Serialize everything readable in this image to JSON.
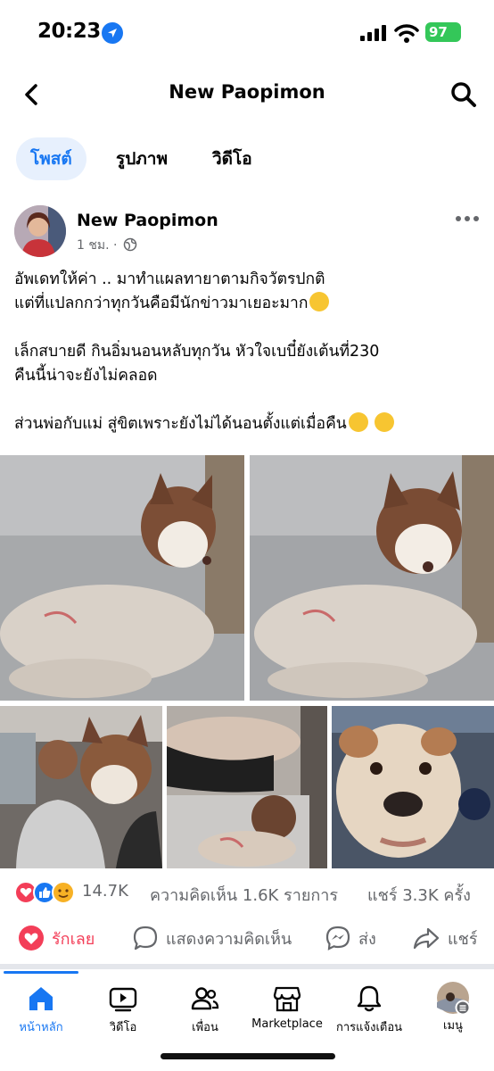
{
  "status_bar": {
    "time": "20:23",
    "battery": "97"
  },
  "header": {
    "title": "New Paopimon"
  },
  "tabs": [
    {
      "label": "โพสต์",
      "active": true
    },
    {
      "label": "รูปภาพ",
      "active": false
    },
    {
      "label": "วิดีโอ",
      "active": false
    }
  ],
  "post": {
    "author": "New Paopimon",
    "time": "1 ชม. ·",
    "text": {
      "line1": "อัพเดทให้ค่า .. มาทำแผลทายาตามกิจวัตรปกติ",
      "line2": "แต่ที่แปลกกว่าทุกวันคือมีนักข่าวมาเยอะมาก",
      "line3": "เล็กสบายดี กินอิ่มนอนหลับทุกวัน หัวใจเบบี๋ยังเต้นที่230",
      "line4": "คืนนี้น่าจะยังไม่คลอด",
      "line5": "ส่วนพ่อกับแม่ สู่ขิตเพราะยังไม่ได้นอนตั้งแต่เมื่อคืน"
    },
    "reactions_count": "14.7K",
    "comments_count": "ความคิดเห็น 1.6K รายการ",
    "shares_count": "แชร์ 3.3K ครั้ง"
  },
  "actions": {
    "like": "รักเลย",
    "comment": "แสดงความคิดเห็น",
    "send": "ส่ง",
    "share": "แชร์"
  },
  "bottom_nav": [
    {
      "label": "หน้าหลัก",
      "icon": "home-icon",
      "active": true
    },
    {
      "label": "วิดีโอ",
      "icon": "video-icon",
      "active": false
    },
    {
      "label": "เพื่อน",
      "icon": "friends-icon",
      "active": false
    },
    {
      "label": "Marketplace",
      "icon": "marketplace-icon",
      "active": false
    },
    {
      "label": "การแจ้งเตือน",
      "icon": "bell-icon",
      "active": false
    },
    {
      "label": "เมนู",
      "icon": "menu-avatar",
      "active": false
    }
  ],
  "colors": {
    "accent": "#1877F2",
    "love": "#F33E58",
    "secondary_text": "#65676B"
  }
}
